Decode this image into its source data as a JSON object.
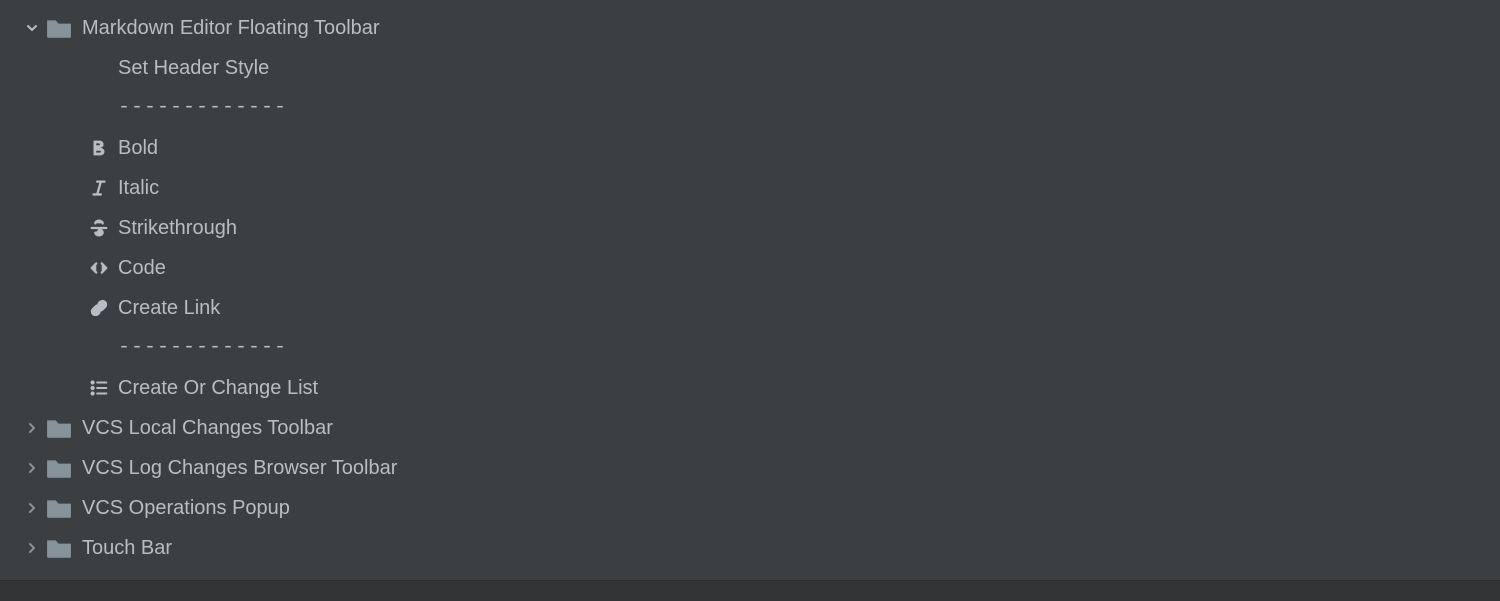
{
  "tree": {
    "markdown_toolbar": {
      "label": "Markdown Editor Floating Toolbar",
      "children": {
        "set_header": "Set Header Style",
        "sep1": "-------------",
        "bold": "Bold",
        "italic": "Italic",
        "strike": "Strikethrough",
        "code": "Code",
        "link": "Create Link",
        "sep2": "-------------",
        "list": "Create Or Change List"
      }
    },
    "vcs_local": "VCS Local Changes Toolbar",
    "vcs_log": "VCS Log Changes Browser Toolbar",
    "vcs_ops": "VCS Operations Popup",
    "touch_bar": "Touch Bar"
  }
}
